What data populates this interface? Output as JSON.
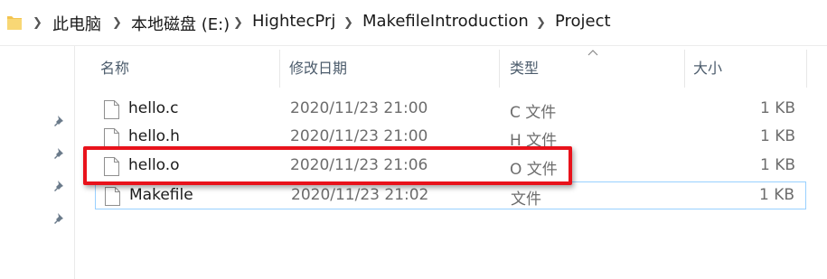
{
  "breadcrumb": {
    "items": [
      "此电脑",
      "本地磁盘 (E:)",
      "HightecPrj",
      "MakefileIntroduction",
      "Project"
    ]
  },
  "columns": {
    "name": "名称",
    "date": "修改日期",
    "type": "类型",
    "size": "大小"
  },
  "files": [
    {
      "name": "hello.c",
      "date": "2020/11/23 21:00",
      "type": "C 文件",
      "size": "1 KB"
    },
    {
      "name": "hello.h",
      "date": "2020/11/23 21:00",
      "type": "H 文件",
      "size": "1 KB"
    },
    {
      "name": "hello.o",
      "date": "2020/11/23 21:06",
      "type": "O 文件",
      "size": "1 KB"
    },
    {
      "name": "Makefile",
      "date": "2020/11/23 21:02",
      "type": "文件",
      "size": "1 KB"
    }
  ],
  "colors": {
    "highlight": "#e8121b",
    "selection_border": "#99d1ff",
    "folder": "#f3c44f"
  },
  "icons": {
    "folder": "folder-icon",
    "chevron": "chevron-right-icon",
    "pin": "pin-icon",
    "file": "file-icon",
    "sort": "sort-up-icon"
  }
}
